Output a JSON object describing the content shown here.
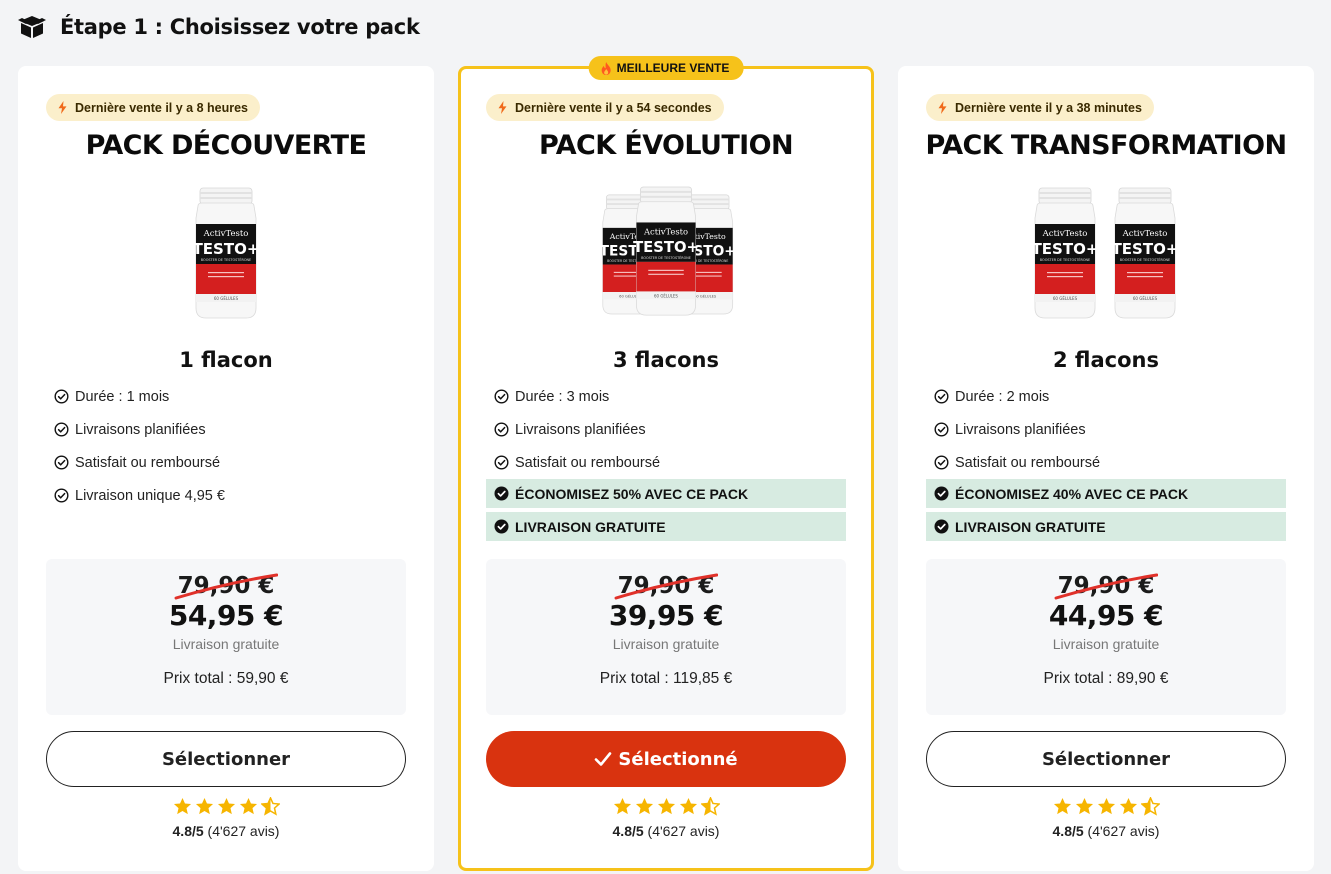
{
  "header": {
    "title": "Étape 1 : Choisissez votre pack",
    "icon": "box-icon"
  },
  "colors": {
    "accent": "#d9330f",
    "highlight_border": "#f6c21a",
    "badge_bg": "#fbefcb",
    "feature_highlight": "#d7ebe1",
    "star": "#f6b500"
  },
  "packs": [
    {
      "last_sale": "Dernière vente il y a 8 heures",
      "title": "PACK DÉCOUVERTE",
      "bottles": 1,
      "quantity": "1 flacon",
      "features": [
        "Durée : 1 mois",
        "Livraisons planifiées",
        "Satisfait ou remboursé",
        "Livraison unique 4,95 €"
      ],
      "highlights": [],
      "old_price": "79,90 €",
      "new_price": "54,95 €",
      "shipping": "Livraison gratuite",
      "total": "Prix total : 59,90 €",
      "button": "Sélectionner",
      "selected": false,
      "stars": 4.5,
      "rating_score": "4.8/5",
      "rating_count": " (4'627 avis)"
    },
    {
      "badge": "MEILLEURE VENTE",
      "last_sale": "Dernière vente il y a 54 secondes",
      "title": "PACK ÉVOLUTION",
      "bottles": 3,
      "quantity": "3 flacons",
      "features": [
        "Durée : 3 mois",
        "Livraisons planifiées",
        "Satisfait ou remboursé"
      ],
      "highlights": [
        "ÉCONOMISEZ 50% AVEC CE PACK",
        "LIVRAISON GRATUITE"
      ],
      "old_price": "79,90 €",
      "new_price": "39,95 €",
      "shipping": "Livraison gratuite",
      "total": "Prix total : 119,85 €",
      "button": "Sélectionné",
      "selected": true,
      "stars": 4.5,
      "rating_score": "4.8/5",
      "rating_count": " (4'627 avis)"
    },
    {
      "last_sale": "Dernière vente il y a 38 minutes",
      "title": "PACK TRANSFORMATION",
      "bottles": 2,
      "quantity": "2 flacons",
      "features": [
        "Durée : 2 mois",
        "Livraisons planifiées",
        "Satisfait ou remboursé"
      ],
      "highlights": [
        "ÉCONOMISEZ 40% AVEC CE PACK",
        "LIVRAISON GRATUITE"
      ],
      "old_price": "79,90 €",
      "new_price": "44,95 €",
      "shipping": "Livraison gratuite",
      "total": "Prix total : 89,90 €",
      "button": "Sélectionner",
      "selected": false,
      "stars": 4.5,
      "rating_score": "4.8/5",
      "rating_count": " (4'627 avis)"
    }
  ],
  "bottle_label": {
    "brand": "ActivTesto",
    "name": "TESTO+",
    "sub": "BOOSTER DE TESTOSTÉRONE",
    "count": "60 GÉLULES"
  }
}
